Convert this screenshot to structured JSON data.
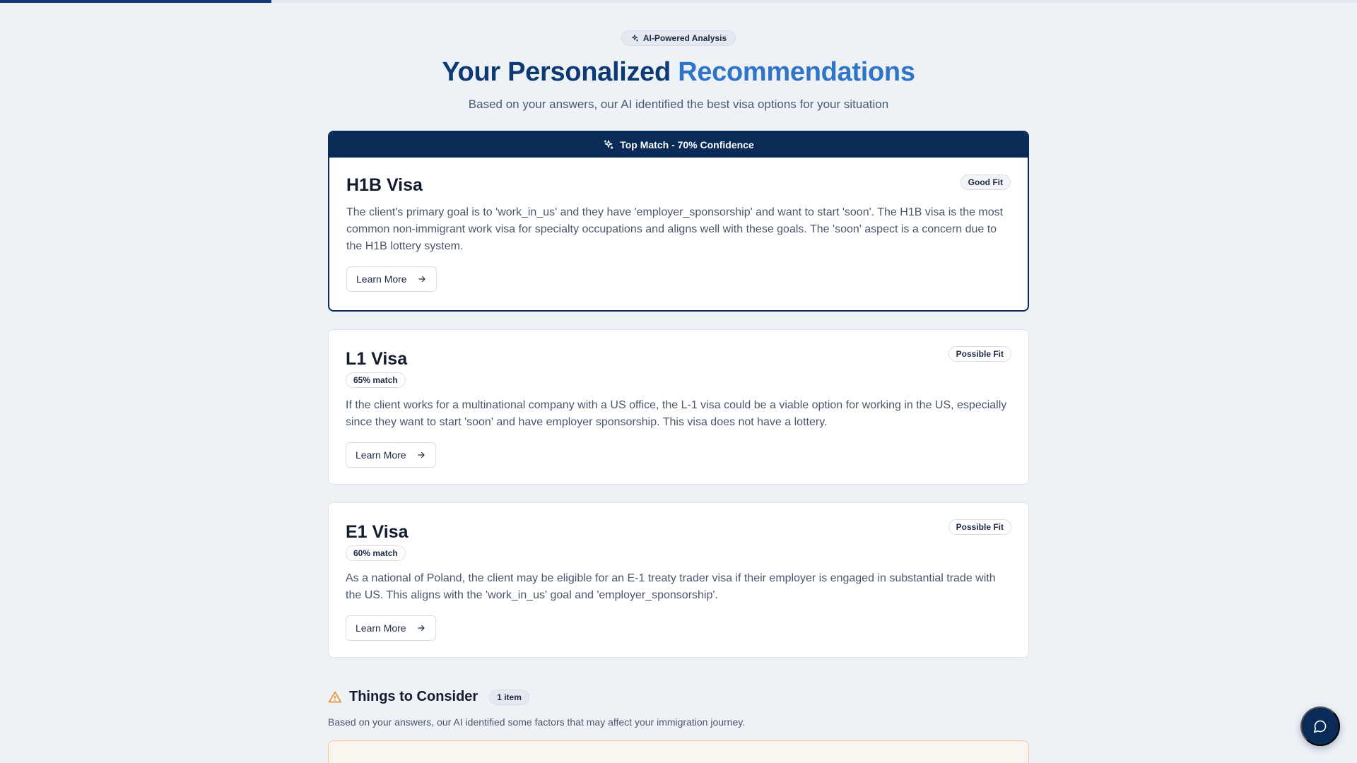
{
  "progress": {
    "fraction": 0.2
  },
  "hero": {
    "pill_label": "AI-Powered Analysis",
    "pill_icon": "sparkles-icon",
    "title_part1": "Your Personalized",
    "title_part2": "Recommendations",
    "subtitle": "Based on your answers, our AI identified the best visa options for your situation"
  },
  "top_match": {
    "banner": "Top Match - 70% Confidence",
    "title": "H1B Visa",
    "fit": "Good Fit",
    "description": "The client's primary goal is to 'work_in_us' and they have 'employer_sponsorship' and want to start 'soon'. The H1B visa is the most common non-immigrant work visa for specialty occupations and aligns well with these goals. The 'soon' aspect is a concern due to the H1B lottery system.",
    "button": "Learn More"
  },
  "alternatives": [
    {
      "title": "L1 Visa",
      "match": "65% match",
      "fit": "Possible Fit",
      "description": "If the client works for a multinational company with a US office, the L-1 visa could be a viable option for working in the US, especially since they want to start 'soon' and have employer sponsorship. This visa does not have a lottery.",
      "button": "Learn More"
    },
    {
      "title": "E1 Visa",
      "match": "60% match",
      "fit": "Possible Fit",
      "description": "As a national of Poland, the client may be eligible for an E-1 treaty trader visa if their employer is engaged in substantial trade with the US. This aligns with the 'work_in_us' goal and 'employer_sponsorship'.",
      "button": "Learn More"
    }
  ],
  "consider": {
    "title": "Things to Consider",
    "count": "1 item",
    "description": "Based on your answers, our AI identified some factors that may affect your immigration journey."
  },
  "colors": {
    "navy": "#0a2a57",
    "title_blue_dark": "#0d3a75",
    "title_blue_light": "#2f74c7",
    "warning": "#e8922e"
  }
}
